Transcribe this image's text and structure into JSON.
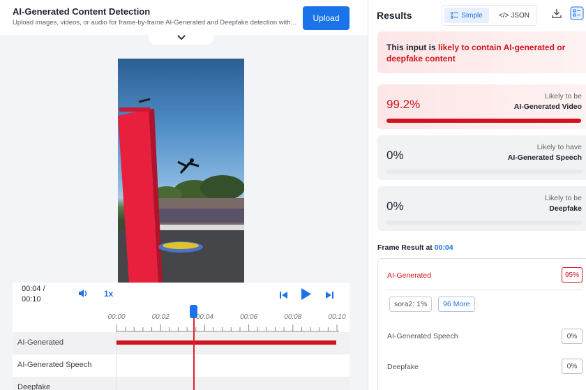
{
  "header": {
    "title": "AI-Generated Content Detection",
    "subtitle": "Upload images, videos, or audio for frame-by-frame AI-Generated and Deepfake detection with...",
    "upload_label": "Upload"
  },
  "player": {
    "time_current": "00:04 /",
    "time_total": "00:10",
    "speed": "1x",
    "ticks": [
      "00:00",
      "00:02",
      "00:04",
      "00:06",
      "00:08",
      "00:10"
    ],
    "playhead_time_fraction": 0.4
  },
  "tracks": [
    {
      "label": "AI-Generated",
      "active": true
    },
    {
      "label": "AI-Generated Speech",
      "active": false
    },
    {
      "label": "Deepfake",
      "active": false
    }
  ],
  "results": {
    "title": "Results",
    "toggle_simple": "Simple",
    "toggle_json": "</> JSON",
    "alert_prefix": "This input is ",
    "alert_highlight": "likely to contain AI-generated or deepfake content",
    "cards": [
      {
        "pct": "99.2%",
        "line1": "Likely to be",
        "line2": "AI-Generated Video",
        "fill": 0.992
      },
      {
        "pct": "0%",
        "line1": "Likely to have",
        "line2": "AI-Generated Speech",
        "fill": 0
      },
      {
        "pct": "0%",
        "line1": "Likely to be",
        "line2": "Deepfake",
        "fill": 0
      }
    ]
  },
  "frame": {
    "heading": "Frame Result at ",
    "time": "00:04",
    "rows": [
      {
        "label": "AI-Generated",
        "value": "95%"
      },
      {
        "label": "AI-Generated Speech",
        "value": "0%"
      },
      {
        "label": "Deepfake",
        "value": "0%"
      }
    ],
    "chips": [
      "sora2: 1%",
      "96 More"
    ]
  },
  "colors": {
    "accent": "#1a73e8",
    "danger": "#d0141f"
  }
}
